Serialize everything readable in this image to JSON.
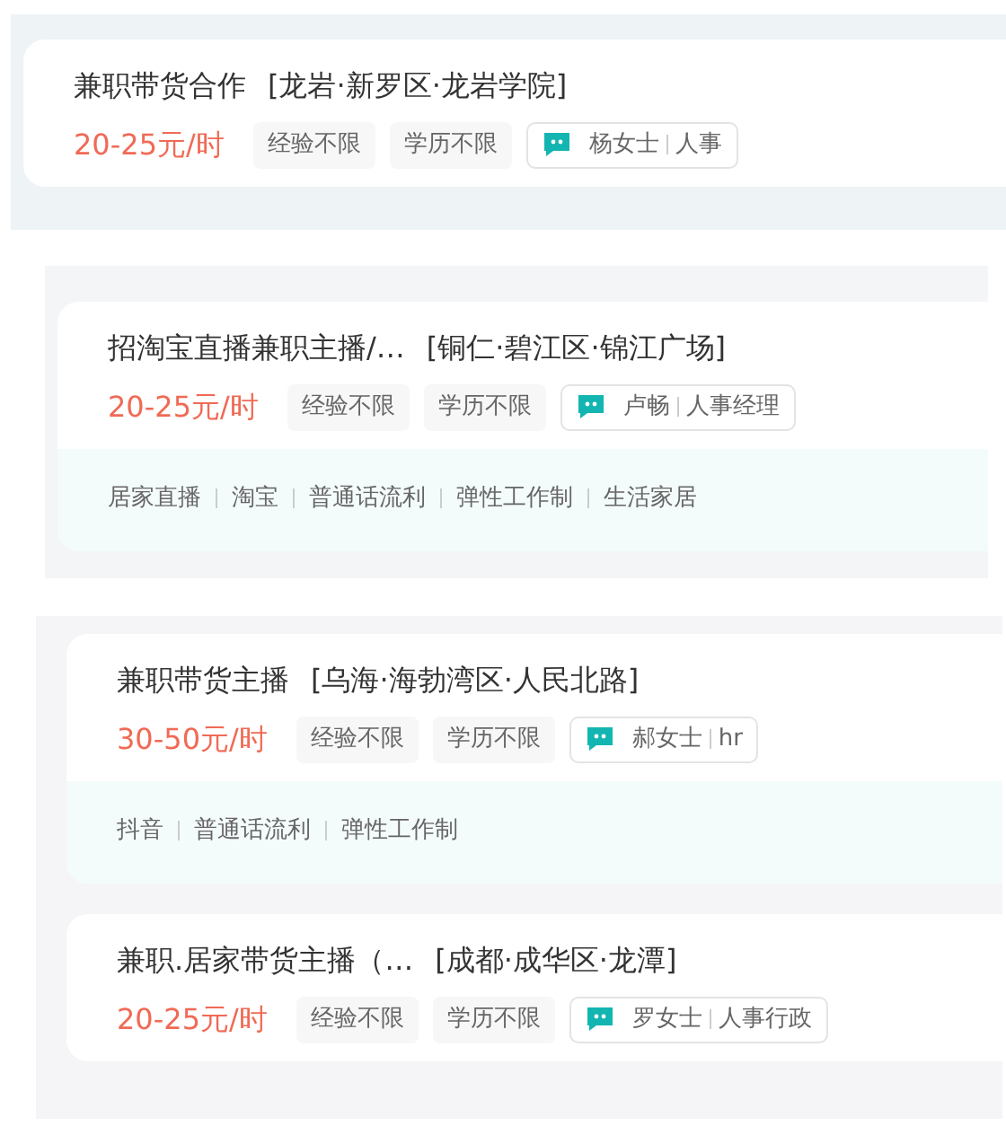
{
  "panels": [
    {
      "cards": [
        {
          "title": "兼职带货合作",
          "location": "[龙岩·新罗区·龙岩学院]",
          "salary": "20-25元/时",
          "tags": [
            "经验不限",
            "学历不限"
          ],
          "recruiter": {
            "name": "杨女士",
            "role": "人事"
          }
        }
      ]
    },
    {
      "cards": [
        {
          "title": "招淘宝直播兼职主播/…",
          "location": "[铜仁·碧江区·锦江广场]",
          "salary": "20-25元/时",
          "tags": [
            "经验不限",
            "学历不限"
          ],
          "recruiter": {
            "name": "卢畅",
            "role": "人事经理"
          },
          "skills": [
            "居家直播",
            "淘宝",
            "普通话流利",
            "弹性工作制",
            "生活家居"
          ]
        }
      ]
    },
    {
      "cards": [
        {
          "title": "兼职带货主播",
          "location": "[乌海·海勃湾区·人民北路]",
          "salary": "30-50元/时",
          "tags": [
            "经验不限",
            "学历不限"
          ],
          "recruiter": {
            "name": "郝女士",
            "role": "hr"
          },
          "skills": [
            "抖音",
            "普通话流利",
            "弹性工作制"
          ]
        },
        {
          "title": "兼职.居家带货主播（…",
          "location": "[成都·成华区·龙潭]",
          "salary": "20-25元/时",
          "tags": [
            "经验不限",
            "学历不限"
          ],
          "recruiter": {
            "name": "罗女士",
            "role": "人事行政"
          }
        }
      ]
    }
  ]
}
